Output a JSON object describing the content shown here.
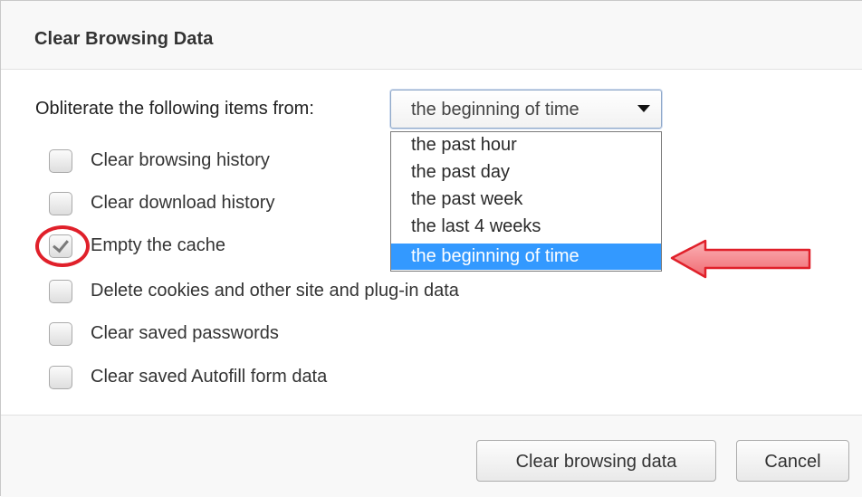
{
  "dialog": {
    "title": "Clear Browsing Data"
  },
  "range": {
    "prompt": "Obliterate the following items from:",
    "selected_value": "the beginning of time",
    "options": [
      "the past hour",
      "the past day",
      "the past week",
      "the last 4 weeks",
      "the beginning of time"
    ],
    "highlighted_option_index": 4
  },
  "checkboxes": [
    {
      "label": "Clear browsing history",
      "checked": false
    },
    {
      "label": "Clear download history",
      "checked": false
    },
    {
      "label": "Empty the cache",
      "checked": true
    },
    {
      "label": "Delete cookies and other site and plug-in data",
      "checked": false
    },
    {
      "label": "Clear saved passwords",
      "checked": false
    },
    {
      "label": "Clear saved Autofill form data",
      "checked": false
    }
  ],
  "buttons": {
    "clear_label": "Clear browsing data",
    "cancel_label": "Cancel"
  },
  "annotations": {
    "circle_color": "#e0202a",
    "arrow_color": "#f2727a",
    "icons": [
      "chevron-down-icon",
      "checkmark-icon",
      "red-circle-annotation",
      "red-arrow-annotation"
    ]
  },
  "colors": {
    "selection_blue": "#3399ff"
  }
}
